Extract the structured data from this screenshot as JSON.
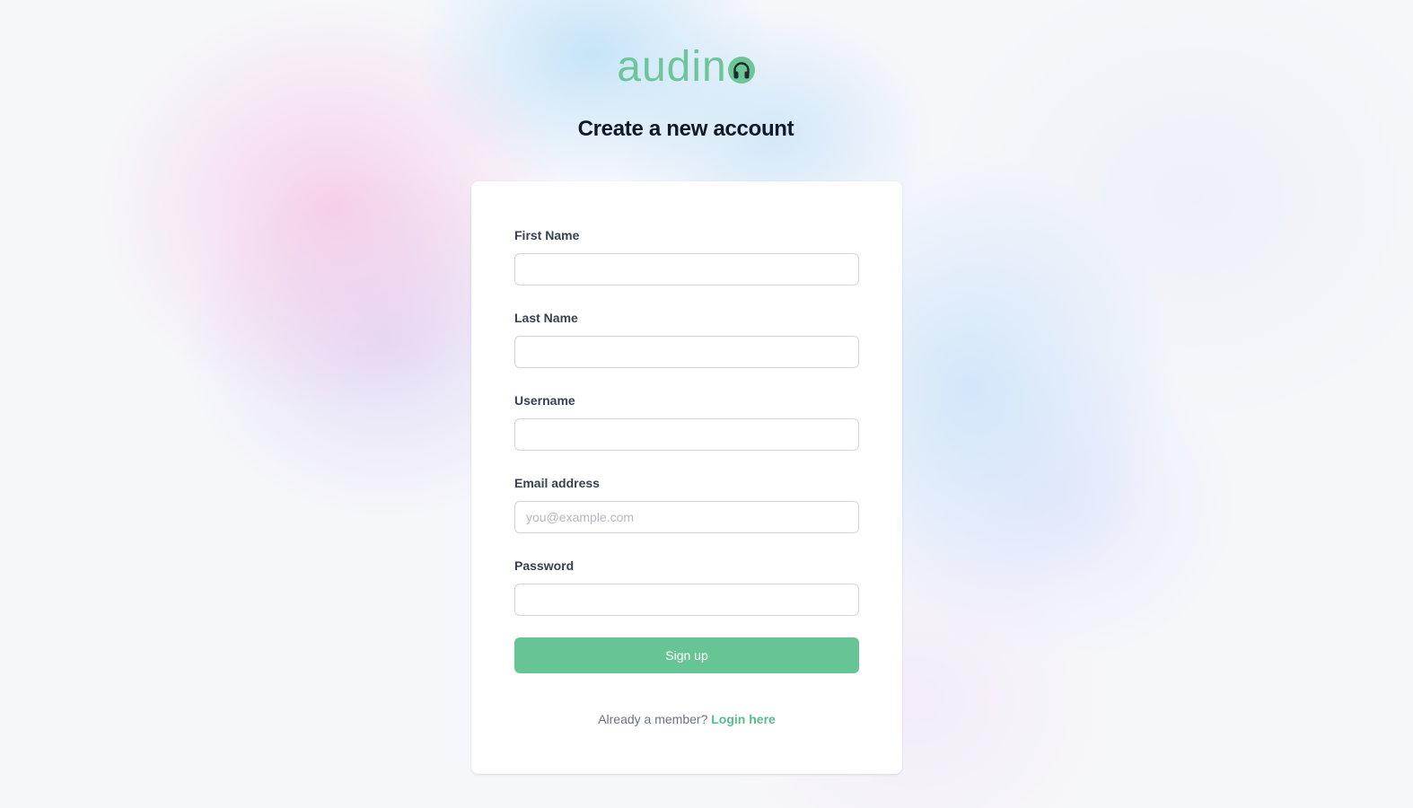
{
  "brand": {
    "name": "audin",
    "icon": "headphones-icon",
    "color": "#6cc698"
  },
  "page": {
    "title": "Create a new account"
  },
  "form": {
    "fields": [
      {
        "label": "First Name",
        "value": "",
        "placeholder": "",
        "type": "text"
      },
      {
        "label": "Last Name",
        "value": "",
        "placeholder": "",
        "type": "text"
      },
      {
        "label": "Username",
        "value": "",
        "placeholder": "",
        "type": "text"
      },
      {
        "label": "Email address",
        "value": "",
        "placeholder": "you@example.com",
        "type": "email"
      },
      {
        "label": "Password",
        "value": "",
        "placeholder": "",
        "type": "password"
      }
    ],
    "submit_label": "Sign up",
    "submit_color": "#66c495"
  },
  "footer": {
    "prompt": "Already a member?",
    "link_label": "Login here",
    "link_color": "#58bc8a"
  }
}
